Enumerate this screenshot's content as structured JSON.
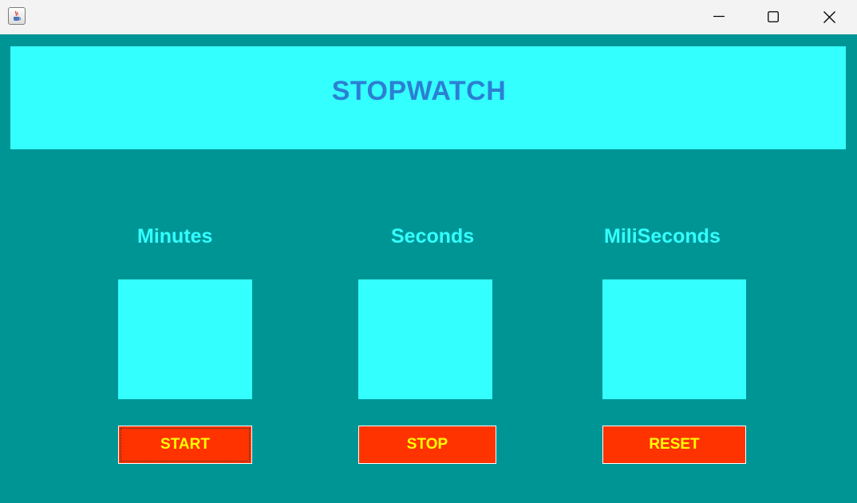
{
  "window": {
    "title": "",
    "icon": "java-cup-icon",
    "controls": [
      "minimize-icon",
      "maximize-icon",
      "close-icon"
    ]
  },
  "header": {
    "title": "STOPWATCH"
  },
  "columns": {
    "minutes": {
      "label": "Minutes",
      "value": ""
    },
    "seconds": {
      "label": "Seconds",
      "value": ""
    },
    "milliseconds": {
      "label": "MiliSeconds",
      "value": ""
    }
  },
  "buttons": {
    "start": "START",
    "stop": "STOP",
    "reset": "RESET"
  },
  "colors": {
    "background": "#009595",
    "panel": "#33ffff",
    "title_text": "#2b7fd3",
    "label_text": "#33ffff",
    "button_bg": "#ff3300",
    "button_text": "#ffff00"
  }
}
